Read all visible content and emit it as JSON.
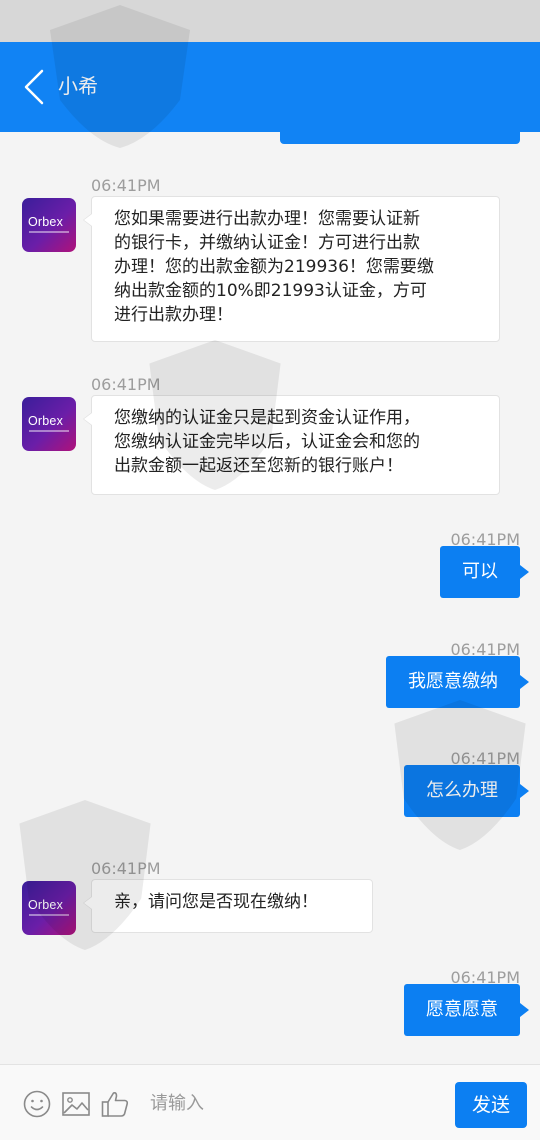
{
  "header": {
    "title": "小希"
  },
  "messages": [
    {
      "side": "in",
      "time": "06:41PM",
      "lines": [
        "您如果需要进行出款办理！您需要认证新",
        "的银行卡，并缴纳认证金！方可进行出款",
        "办理！您的出款金额为219936！您需要缴",
        "纳出款金额的10%即21993认证金，方可",
        "进行出款办理！"
      ]
    },
    {
      "side": "in",
      "time": "06:41PM",
      "lines": [
        "您缴纳的认证金只是起到资金认证作用，",
        "您缴纳认证金完毕以后，认证金会和您的",
        "出款金额一起返还至您新的银行账户！"
      ]
    },
    {
      "side": "out",
      "time": "06:41PM",
      "text": "可以"
    },
    {
      "side": "out",
      "time": "06:41PM",
      "text": "我愿意缴纳"
    },
    {
      "side": "out",
      "time": "06:41PM",
      "text": "怎么办理"
    },
    {
      "side": "in",
      "time": "06:41PM",
      "lines": [
        "亲，请问您是否现在缴纳！"
      ]
    },
    {
      "side": "out",
      "time": "06:41PM",
      "text": "愿意愿意"
    }
  ],
  "avatar": {
    "brand": "Orbex"
  },
  "input": {
    "placeholder": "请输入",
    "value": "",
    "send_label": "发送"
  },
  "colors": {
    "accent": "#1183f4",
    "bubble_out": "#0c7ff2",
    "background": "#f4f4f4"
  },
  "icons": [
    "back-chevron-icon",
    "emoji-icon",
    "image-icon",
    "thumbs-up-icon"
  ]
}
